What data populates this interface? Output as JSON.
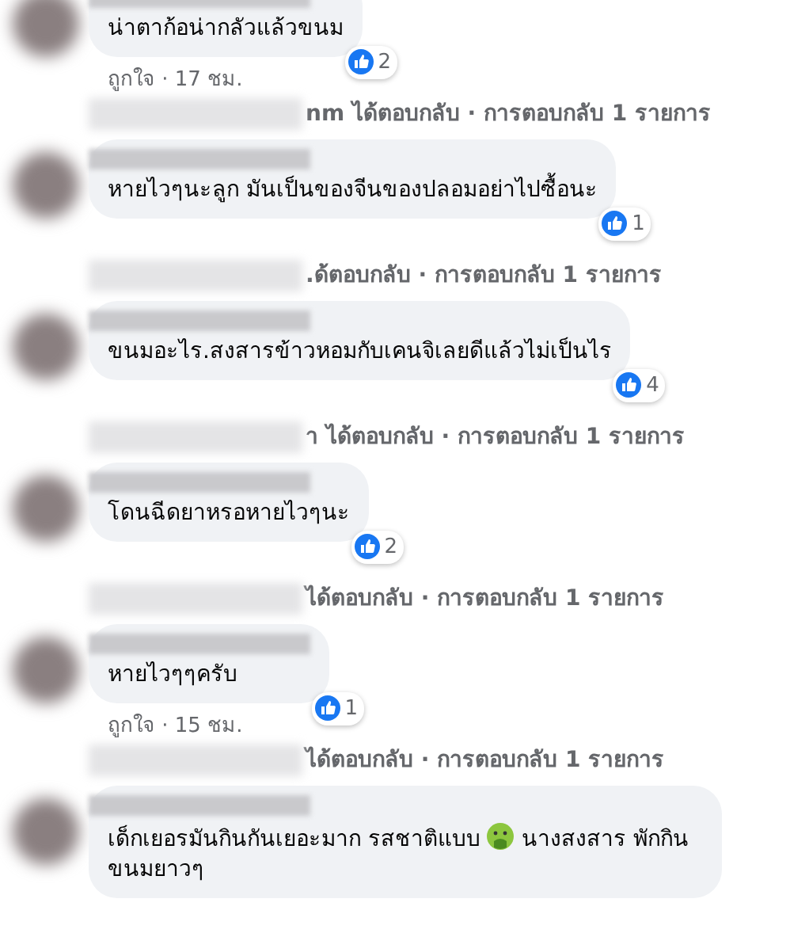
{
  "comments": [
    {
      "segments": [
        {
          "kind": "text",
          "text": "น่าตาก้อน่ากลัวแล้วขนม"
        }
      ],
      "reactions": "2",
      "meta": "ถูกใจ · 17 ชม.",
      "reply": "nm ได้ตอบกลับ · การตอบกลับ 1 รายการ"
    },
    {
      "segments": [
        {
          "kind": "text",
          "text": "หายไวๆนะลูก มันเป็นของจีนของปลอมอย่าไปซื้อนะ"
        }
      ],
      "reactions": "1",
      "reply": ".ด้ตอบกลับ · การตอบกลับ 1 รายการ"
    },
    {
      "segments": [
        {
          "kind": "text",
          "text": "ขนมอะไร.สงสารข้าวหอมกับเคนจิเลยดีแล้วไม่เป็นไร"
        }
      ],
      "reactions": "4",
      "reply": "า ได้ตอบกลับ · การตอบกลับ 1 รายการ"
    },
    {
      "segments": [
        {
          "kind": "text",
          "text": "โดนฉีดยาหรอหายไวๆนะ"
        }
      ],
      "reactions": "2",
      "reply": "ได้ตอบกลับ · การตอบกลับ 1 รายการ"
    },
    {
      "segments": [
        {
          "kind": "text",
          "text": "หายไวๆๆครับ"
        }
      ],
      "reactions": "1",
      "meta": "ถูกใจ · 15 ชม.",
      "reply": "ได้ตอบกลับ · การตอบกลับ 1 รายการ"
    },
    {
      "segments": [
        {
          "kind": "text",
          "text": "เด็กเยอรมันกินกันเยอะมาก รสชาติแบบ"
        },
        {
          "kind": "emoji"
        },
        {
          "kind": "text",
          "text": "นางสงสาร พักกิน"
        },
        {
          "kind": "text",
          "text": "ขนมยาวๆ"
        }
      ]
    }
  ]
}
